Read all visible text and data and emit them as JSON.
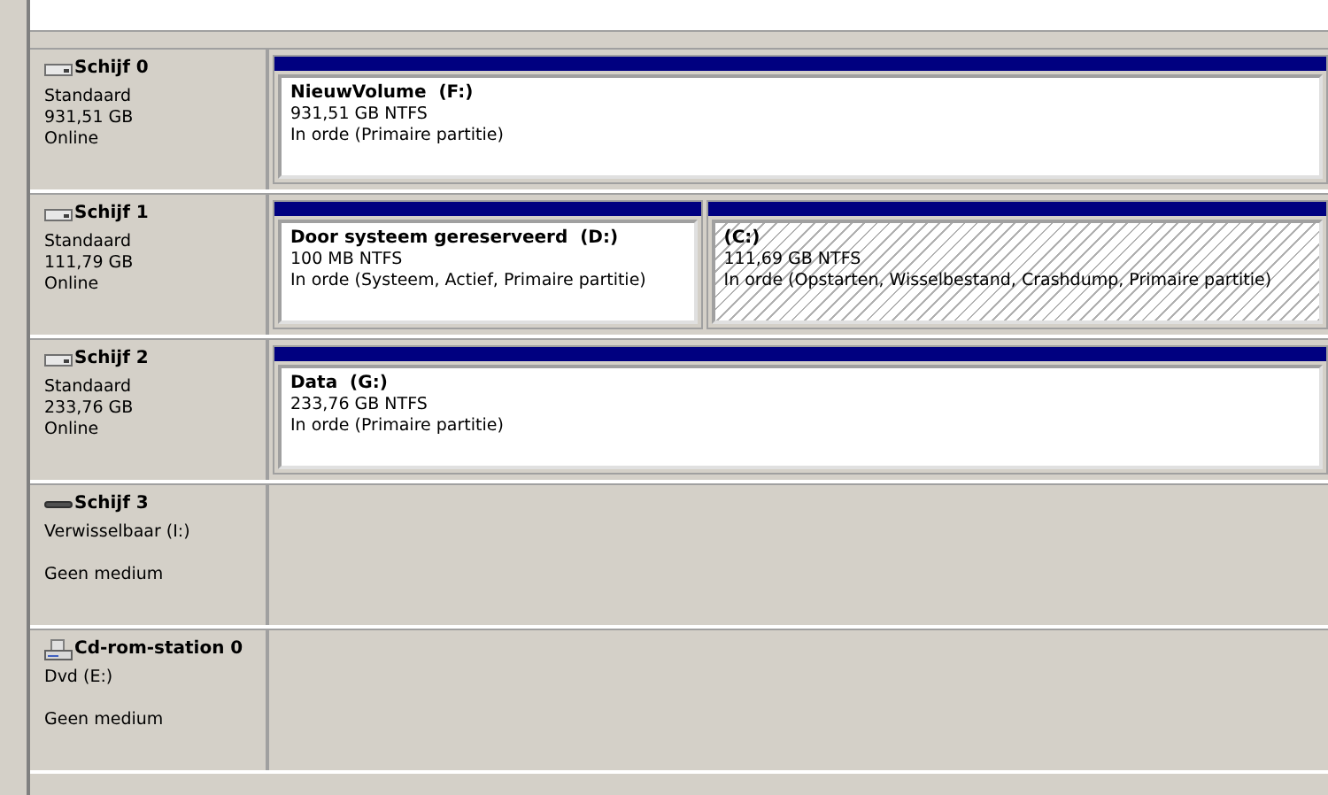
{
  "disks": [
    {
      "kind": "disk",
      "name": "Schijf 0",
      "type": "Standaard",
      "size": "931,51 GB",
      "status": "Online",
      "partitions": [
        {
          "label": "NieuwVolume  (F:)",
          "size": "931,51 GB NTFS",
          "health": "In orde (Primaire partitie)",
          "selected": false
        }
      ]
    },
    {
      "kind": "disk",
      "name": "Schijf 1",
      "type": "Standaard",
      "size": "111,79 GB",
      "status": "Online",
      "partitions": [
        {
          "label": "Door systeem gereserveerd  (D:)",
          "size": "100 MB NTFS",
          "health": "In orde (Systeem, Actief, Primaire partitie)",
          "selected": false
        },
        {
          "label": "(C:)",
          "size": "111,69 GB NTFS",
          "health": "In orde (Opstarten, Wisselbestand, Crashdump, Primaire partitie)",
          "selected": true
        }
      ]
    },
    {
      "kind": "disk",
      "name": "Schijf 2",
      "type": "Standaard",
      "size": "233,76 GB",
      "status": "Online",
      "partitions": [
        {
          "label": "Data  (G:)",
          "size": "233,76 GB NTFS",
          "health": "In orde (Primaire partitie)",
          "selected": false
        }
      ]
    },
    {
      "kind": "removable",
      "name": "Schijf 3",
      "type": "Verwisselbaar (I:)",
      "status": "Geen medium"
    },
    {
      "kind": "cdrom",
      "name": "Cd-rom-station 0",
      "type": "Dvd (E:)",
      "status": "Geen medium"
    }
  ]
}
